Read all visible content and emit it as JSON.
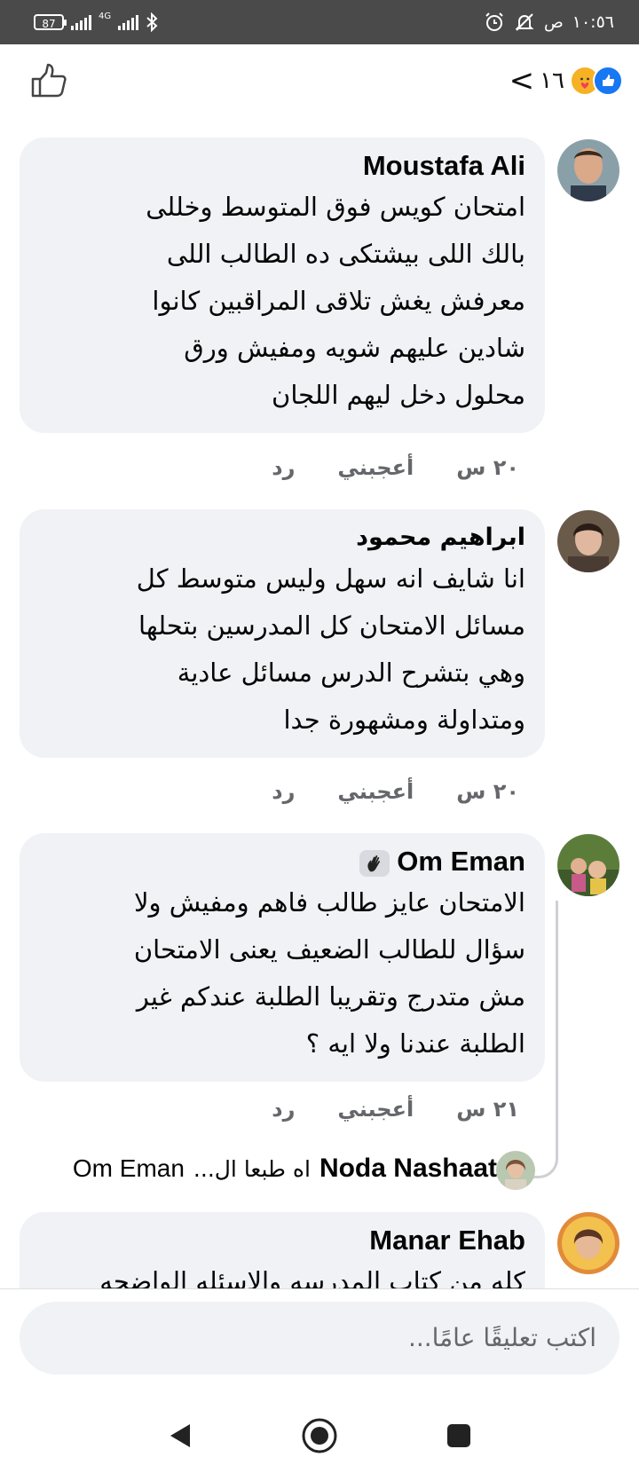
{
  "status_bar": {
    "battery": "87",
    "network": "4G",
    "time": "١٠:٥٦",
    "ampm": "ص"
  },
  "header": {
    "reaction_count": "١٦",
    "like_button_icon": "thumbs-up-outline-icon",
    "back_icon": "chevron-left-icon"
  },
  "comments": [
    {
      "name": "Moustafa Ali",
      "lines": [
        "امتحان كويس فوق المتوسط وخللى",
        "بالك اللى بيشتكى ده الطالب اللى",
        "معرفش يغش تلاقى المراقبين كانوا",
        "شادين عليهم شويه ومفيش ورق",
        "محلول دخل ليهم اللجان"
      ],
      "time": "٢٠ س",
      "like": "أعجبني",
      "reply": "رد"
    },
    {
      "name": "ابراهيم محمود",
      "lines": [
        "انا شايف انه سهل وليس متوسط كل",
        "مسائل الامتحان كل المدرسين بتحلها",
        "وهي بتشرح الدرس مسائل عادية",
        "ومتداولة ومشهورة جدا"
      ],
      "time": "٢٠ س",
      "like": "أعجبني",
      "reply": "رد"
    },
    {
      "name": "Om Eman",
      "badge_icon": "waving-hand-badge-icon",
      "lines": [
        "الامتحان عايز طالب فاهم ومفيش ولا",
        "سؤال للطالب الضعيف يعنى  الامتحان",
        "مش متدرج وتقريبا الطلبة عندكم غير",
        "الطلبة عندنا ولا ايه ؟"
      ],
      "time": "٢١ س",
      "like": "أعجبني",
      "reply": "رد"
    },
    {
      "name": "Manar Ehab",
      "lines": [
        "كله من كتاب المدرسه والاسئله الواضحه"
      ]
    }
  ],
  "reply_preview": {
    "name": "Noda Nashaat",
    "text": "اه طبعا ال...",
    "tail": "Om Eman"
  },
  "composer": {
    "placeholder": "اكتب تعليقًا عامًا..."
  },
  "nav": {
    "back": "back-triangle-icon",
    "home": "home-circle-icon",
    "recent": "recent-square-icon"
  },
  "colors": {
    "bubble": "#f0f2f5",
    "meta_text": "#65676b",
    "like_blue": "#1877f2"
  }
}
